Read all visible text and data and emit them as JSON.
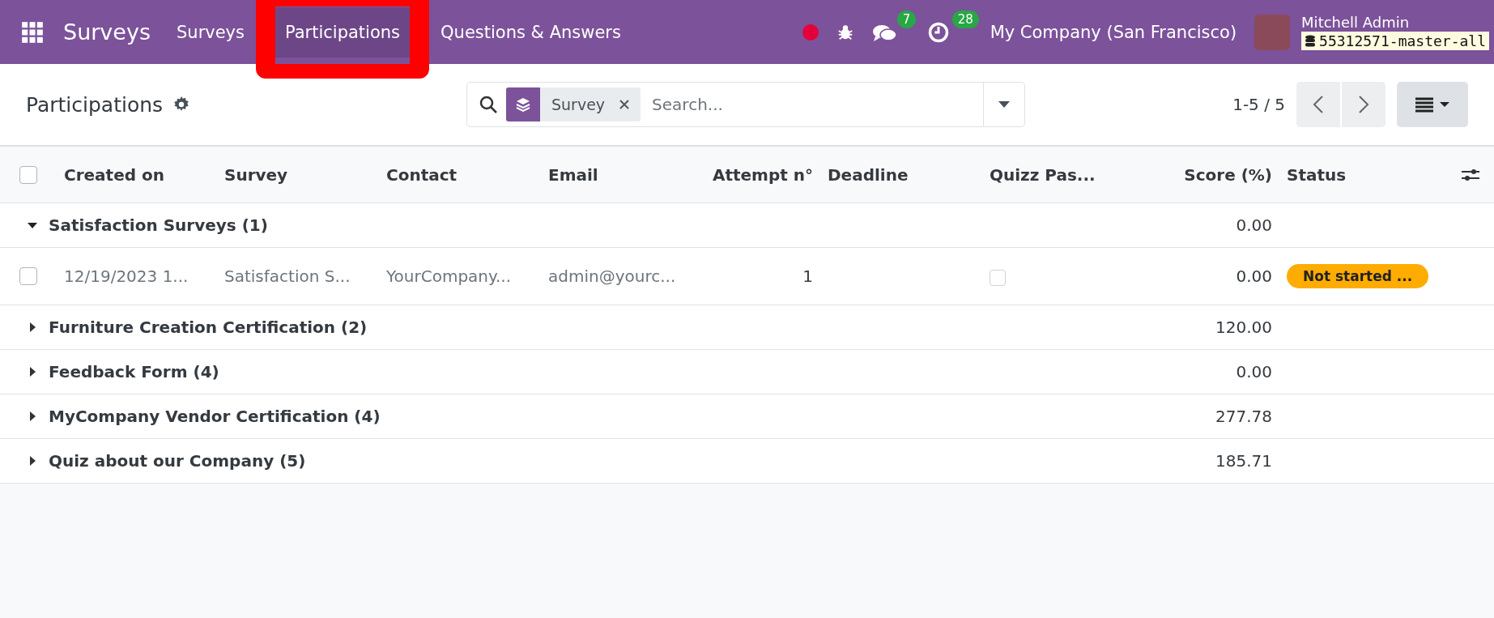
{
  "navbar": {
    "app_name": "Surveys",
    "menu": [
      {
        "label": "Surveys",
        "selected": false,
        "highlighted": false
      },
      {
        "label": "Participations",
        "selected": true,
        "highlighted": true
      },
      {
        "label": "Questions & Answers",
        "selected": false,
        "highlighted": false
      }
    ],
    "messages_badge": "7",
    "activities_badge": "28",
    "company": "My Company (San Francisco)",
    "user_name": "Mitchell Admin",
    "database": "55312571-master-all"
  },
  "control_panel": {
    "title": "Participations",
    "facet": "Survey",
    "search_placeholder": "Search...",
    "pager": "1-5 / 5"
  },
  "table": {
    "select_all_checked": false,
    "columns": [
      "Created on",
      "Survey",
      "Contact",
      "Email",
      "Attempt n°",
      "Deadline",
      "Quizz Pas...",
      "Score (%)",
      "Status"
    ],
    "groups": [
      {
        "label": "Satisfaction Surveys (1)",
        "score": "0.00",
        "expanded": true,
        "rows": [
          {
            "created_on": "12/19/2023 1...",
            "survey": "Satisfaction S...",
            "contact": "YourCompany...",
            "email": "admin@yourc...",
            "attempt": "1",
            "quizz_passed": false,
            "score": "0.00",
            "status": "Not started ...",
            "checked": false
          }
        ]
      },
      {
        "label": "Furniture Creation Certification (2)",
        "score": "120.00",
        "expanded": false
      },
      {
        "label": "Feedback Form (4)",
        "score": "0.00",
        "expanded": false
      },
      {
        "label": "MyCompany Vendor Certification (4)",
        "score": "277.78",
        "expanded": false
      },
      {
        "label": "Quiz about our Company (5)",
        "score": "185.71",
        "expanded": false
      }
    ]
  }
}
